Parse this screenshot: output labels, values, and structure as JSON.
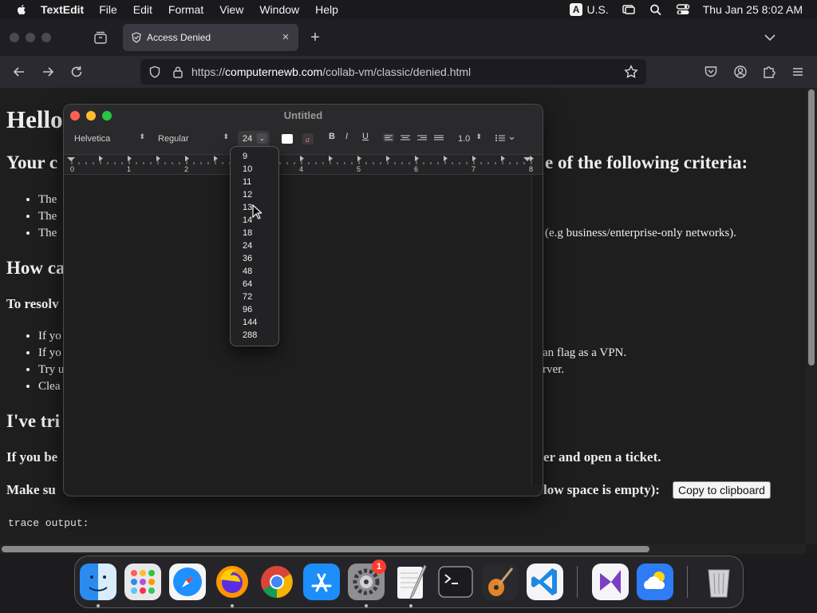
{
  "menubar": {
    "app_name": "TextEdit",
    "items": [
      "File",
      "Edit",
      "Format",
      "View",
      "Window",
      "Help"
    ],
    "input_badge": "A",
    "input_source": "U.S.",
    "datetime": "Thu Jan 25  8:02 AM"
  },
  "browser": {
    "tab_title": "Access Denied",
    "url_prefix": "https://",
    "url_host": "computernewb.com",
    "url_path": "/collab-vm/classic/denied.html"
  },
  "page": {
    "h1": "Hello",
    "h2_criteria_left": "Your c",
    "h2_criteria_right": "e of the following criteria:",
    "bullets1": [
      "The",
      "The",
      "The"
    ],
    "bullet1_3_right": "(e.g business/enterprise-only networks).",
    "h2_how": "How ca",
    "h4_resolve": "To resolv",
    "bullets2": [
      "If yo",
      "If yo",
      "Try u",
      "Clea"
    ],
    "bullet2_2_right": "an flag as a VPN.",
    "bullet2_3_right": "rver.",
    "h2_tried": "I've tri",
    "h4_ticket_left": "If you be",
    "h4_ticket_right": "er and open a ticket.",
    "h4_make_left": "Make su",
    "h4_make_right": "low space is empty):",
    "copy_button": "Copy to clipboard",
    "trace_label": "trace output:"
  },
  "textedit": {
    "title": "Untitled",
    "font_family": "Helvetica",
    "font_style": "Regular",
    "font_size": "24",
    "bold": "B",
    "italic": "I",
    "underline": "U",
    "line_spacing": "1.0",
    "ruler_numbers": [
      "0",
      "1",
      "2",
      "3",
      "4",
      "5",
      "6",
      "7",
      "8"
    ],
    "size_options": [
      "9",
      "10",
      "11",
      "12",
      "13",
      "14",
      "18",
      "24",
      "36",
      "48",
      "64",
      "72",
      "96",
      "144",
      "288"
    ]
  },
  "dock": {
    "settings_badge": "1",
    "apps": [
      "Finder",
      "Launchpad",
      "Safari",
      "Firefox",
      "Chrome",
      "App Store",
      "System Settings",
      "TextEdit",
      "Terminal",
      "GarageBand",
      "Visual Studio Code",
      "Visual Studio",
      "Weather",
      "Trash"
    ]
  },
  "colors": {
    "page_bg": "#1e1e1e",
    "firefox_toolbar": "#2b2a33",
    "close_red": "#ff5f57",
    "minimize_yellow": "#febc2e",
    "zoom_green": "#28c840",
    "badge_red": "#ff3b30"
  }
}
